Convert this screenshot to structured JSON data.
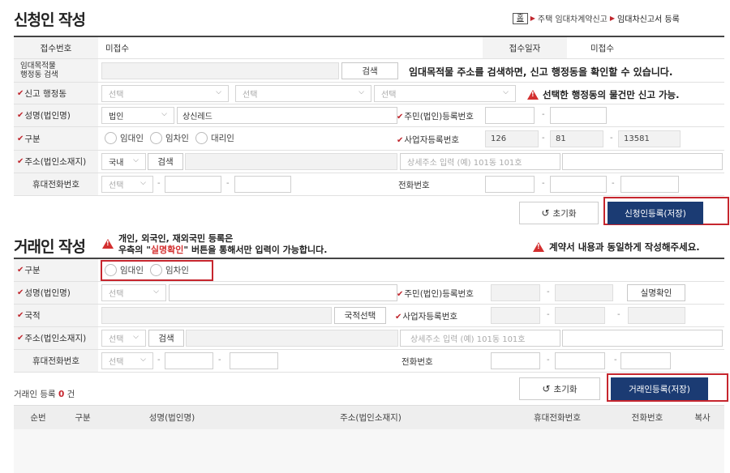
{
  "applicant": {
    "title": "신청인 작성",
    "breadcrumb": {
      "home": "홈",
      "step1": "주택 임대차계약신고",
      "step2": "임대차신고서 등록"
    },
    "receipt_no_label": "접수번호",
    "receipt_no_value": "미접수",
    "receipt_date_label": "접수일자",
    "receipt_date_value": "미접수",
    "property_label_line1": "임대목적물",
    "property_label_line2": "행정동 검색",
    "search_button": "검색",
    "property_hint": "임대목적물 주소를 검색하면, 신고 행정동을 확인할 수 있습니다.",
    "district_label": "신고 행정동",
    "district_selects": [
      "선택",
      "선택",
      "선택"
    ],
    "district_notice": "선택한 행정동의 물건만 신고 가능.",
    "name_label": "성명(법인명)",
    "name_type": "법인",
    "name_value": "상신레드",
    "reg_no_label": "주민(법인)등록번호",
    "type_label": "구분",
    "type_options": [
      "임대인",
      "임차인",
      "대리인"
    ],
    "biz_no_label": "사업자등록번호",
    "biz_no": [
      "126",
      "81",
      "13581"
    ],
    "address_label": "주소(법인소재지)",
    "address_country": "국내",
    "address_search": "검색",
    "address_detail_placeholder": "상세주소 입력 (예) 101동 101호",
    "mobile_label": "휴대전화번호",
    "mobile_select": "선택",
    "phone_label": "전화번호",
    "reset_button": "초기화",
    "save_button": "신청인등록(저장)"
  },
  "counterparty": {
    "title": "거래인 작성",
    "notice_line1": "개인, 외국인, 재외국민 등록은",
    "notice_line2_pre": "우측의 \"",
    "notice_line2_em": "실명확인",
    "notice_line2_post": "\" 버튼을 통해서만 입력이 가능합니다.",
    "right_notice": "계약서 내용과 동일하게 작성해주세요.",
    "type_label": "구분",
    "type_options": [
      "임대인",
      "임차인"
    ],
    "name_label": "성명(법인명)",
    "name_select": "선택",
    "reg_no_label": "주민(법인)등록번호",
    "verify_button": "실명확인",
    "nationality_label": "국적",
    "nationality_button": "국적선택",
    "biz_no_label": "사업자등록번호",
    "address_label": "주소(법인소재지)",
    "address_select": "선택",
    "address_search": "검색",
    "address_detail_placeholder": "상세주소 입력 (예) 101동 101호",
    "mobile_label": "휴대전화번호",
    "mobile_select": "선택",
    "phone_label": "전화번호",
    "reset_button": "초기화",
    "save_button": "거래인등록(저장)"
  },
  "list": {
    "count_label_pre": "거래인 등록",
    "count": "0",
    "count_label_post": "건",
    "columns": [
      "순번",
      "구분",
      "성명(법인명)",
      "주소(법인소재지)",
      "휴대전화번호",
      "전화번호",
      "복사"
    ]
  },
  "colors": {
    "accent_red": "#c6262e",
    "navy": "#1b3b73",
    "label_bg": "#f3f3f3"
  }
}
